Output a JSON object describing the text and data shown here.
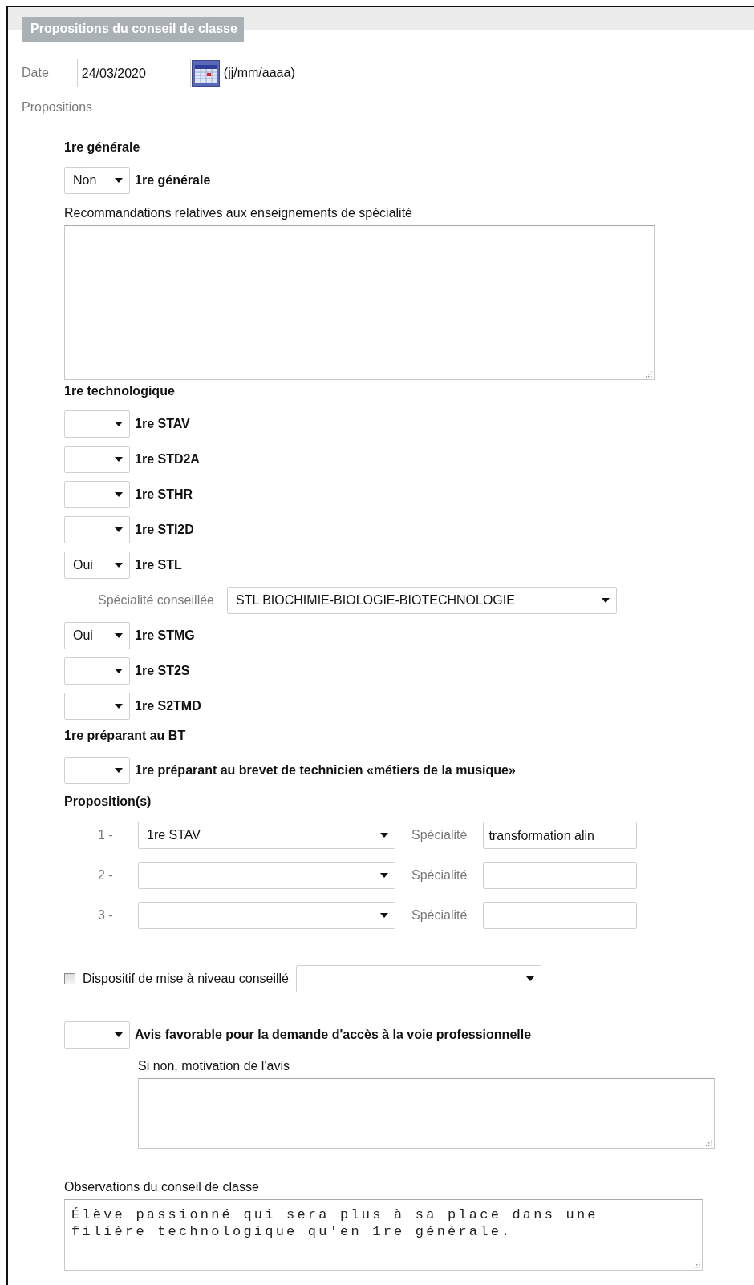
{
  "section": {
    "title": "Propositions du conseil de classe"
  },
  "date": {
    "label": "Date",
    "value": "24/03/2020",
    "format_hint": "(jj/mm/aaaa)"
  },
  "propositions_label": "Propositions",
  "groups": [
    {
      "heading": "1re générale",
      "items": [
        {
          "kind": "choice",
          "answer": "Non",
          "label": "1re générale"
        },
        {
          "kind": "note",
          "label": "Recommandations relatives aux enseignements de spécialité"
        }
      ]
    },
    {
      "heading": "1re technologique",
      "items": [
        {
          "kind": "choice",
          "label": "1re STAV"
        },
        {
          "kind": "choice",
          "label": "1re STD2A"
        },
        {
          "kind": "choice",
          "label": "1re STHR"
        },
        {
          "kind": "choice",
          "label": "1re STI2D"
        },
        {
          "kind": "choice",
          "answer": "Oui",
          "label": "1re STL"
        },
        {
          "kind": "specialty",
          "label": "Spécialité conseillée",
          "value": "STL BIOCHIMIE-BIOLOGIE-BIOTECHNOLOGIE"
        },
        {
          "kind": "choice",
          "answer": "Oui",
          "label": "1re STMG"
        },
        {
          "kind": "choice",
          "label": "1re ST2S"
        },
        {
          "kind": "choice",
          "label": "1re S2TMD"
        }
      ]
    },
    {
      "heading": "1re préparant au BT",
      "items": [
        {
          "kind": "choice",
          "label": "1re préparant au brevet de technicien «métiers de la musique»"
        }
      ]
    }
  ],
  "proposals": {
    "heading": "Proposition(s)",
    "rows": [
      {
        "number": "1 -",
        "choice": "1re STAV",
        "specialty_label": "Spécialité",
        "specialty": "transformation alin"
      },
      {
        "number": "2 -",
        "specialty_label": "Spécialité"
      },
      {
        "number": "3 -",
        "specialty_label": "Spécialité"
      }
    ]
  },
  "remediation": {
    "checked": false,
    "label": "Dispositif de mise à niveau conseillé"
  },
  "vocational": {
    "label": "Avis favorable pour la demande d'accès à la voie professionnelle",
    "motivation_label": "Si non, motivation de l'avis"
  },
  "observations": {
    "label": "Observations du conseil de classe",
    "value": "Élève passionné qui sera plus à sa place dans une filière technologique qu'en 1re générale."
  }
}
